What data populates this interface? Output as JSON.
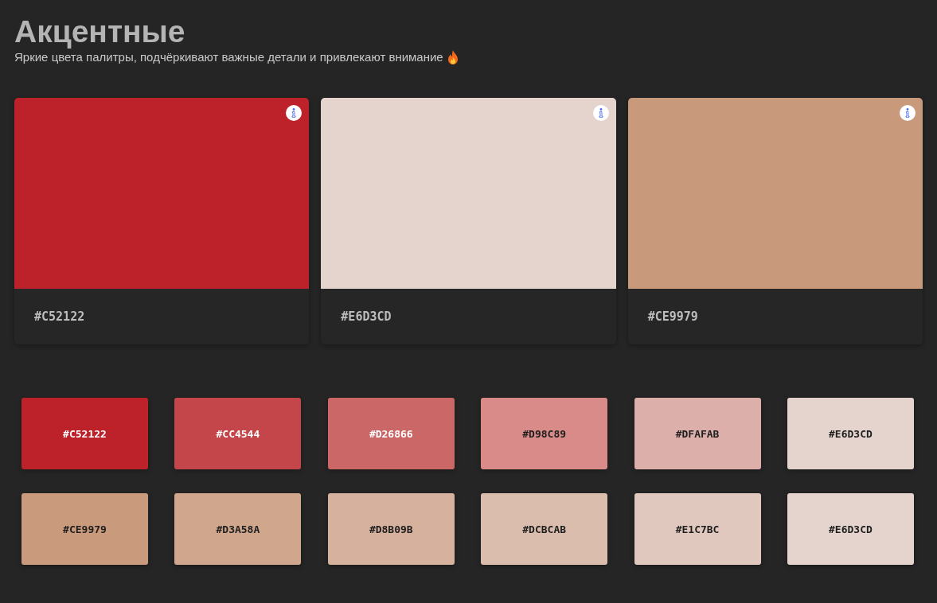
{
  "title": "Акцентные",
  "subtitle": "Яркие цвета палитры, подчёркивают важные детали и привлекают внимание",
  "cards": [
    {
      "hex": "#C52122",
      "color": "#bd2129"
    },
    {
      "hex": "#E6D3CD",
      "color": "#e4d4cd"
    },
    {
      "hex": "#CE9979",
      "color": "#c9997c"
    }
  ],
  "swatch_rows": [
    [
      {
        "hex": "#C52122",
        "color": "#bd2129",
        "kind": "light"
      },
      {
        "hex": "#CC4544",
        "color": "#c4464a",
        "kind": "light"
      },
      {
        "hex": "#D26866",
        "color": "#cb6867",
        "kind": "light"
      },
      {
        "hex": "#D98C89",
        "color": "#d88b89",
        "kind": "dark"
      },
      {
        "hex": "#DFAFAB",
        "color": "#ddafab",
        "kind": "dark"
      },
      {
        "hex": "#E6D3CD",
        "color": "#e4d4cd",
        "kind": "dark"
      }
    ],
    [
      {
        "hex": "#CE9979",
        "color": "#c99a7c",
        "kind": "dark"
      },
      {
        "hex": "#D3A58A",
        "color": "#d0a68d",
        "kind": "dark"
      },
      {
        "hex": "#D8B09B",
        "color": "#d6b19e",
        "kind": "dark"
      },
      {
        "hex": "#DCBCAB",
        "color": "#dbbdae",
        "kind": "dark"
      },
      {
        "hex": "#E1C7BC",
        "color": "#e1c8bf",
        "kind": "dark"
      },
      {
        "hex": "#E6D3CD",
        "color": "#e4d4cd",
        "kind": "dark"
      }
    ]
  ]
}
